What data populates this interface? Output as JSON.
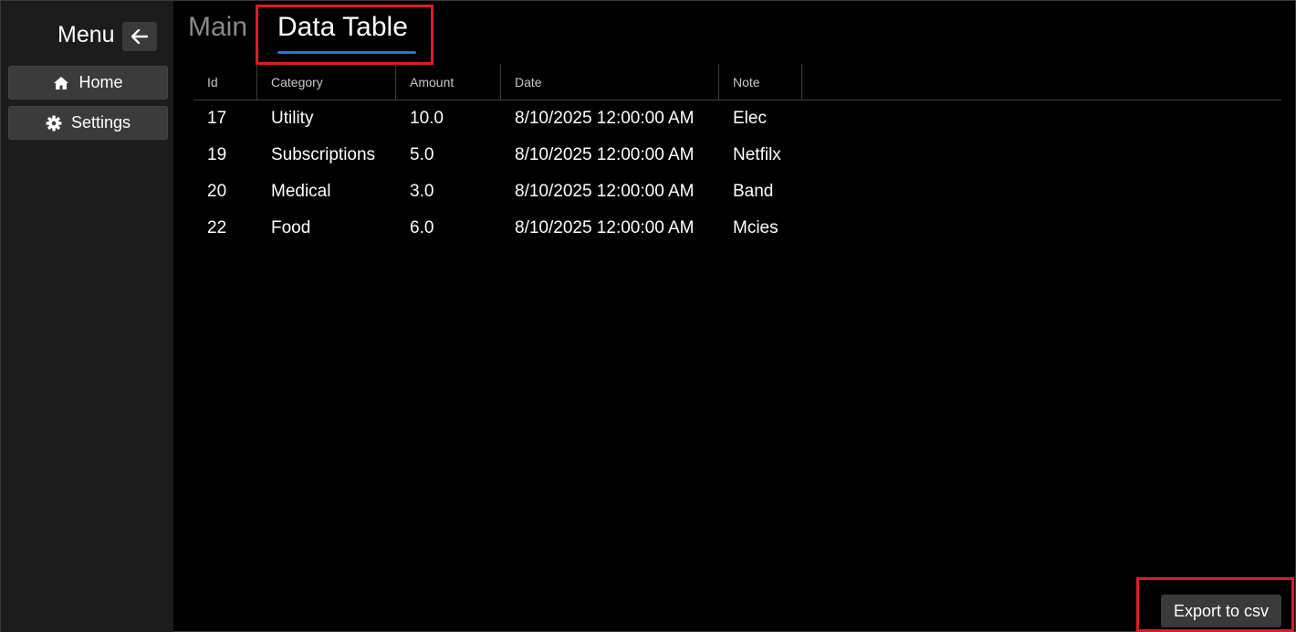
{
  "sidebar": {
    "title": "Menu",
    "back_icon": "arrow-left-icon",
    "items": [
      {
        "label": "Home",
        "icon": "home-icon"
      },
      {
        "label": "Settings",
        "icon": "gear-icon"
      }
    ]
  },
  "tabs": [
    {
      "label": "Main",
      "selected": false
    },
    {
      "label": "Data Table",
      "selected": true
    }
  ],
  "table": {
    "columns": [
      "Id",
      "Category",
      "Amount",
      "Date",
      "Note"
    ],
    "rows": [
      [
        "17",
        "Utility",
        "10.0",
        "8/10/2025 12:00:00 AM",
        "Elec"
      ],
      [
        "19",
        "Subscriptions",
        "5.0",
        "8/10/2025 12:00:00 AM",
        "Netfilx"
      ],
      [
        "20",
        "Medical",
        "3.0",
        "8/10/2025 12:00:00 AM",
        "Band"
      ],
      [
        "22",
        "Food",
        "6.0",
        "8/10/2025 12:00:00 AM",
        "Mcies"
      ]
    ]
  },
  "export_button": {
    "label": "Export to csv"
  },
  "colors": {
    "accent": "#1e7ad6",
    "highlight": "#e01b24",
    "sidebar_bg": "#1c1c1c",
    "button_bg": "#3a3a3a"
  }
}
